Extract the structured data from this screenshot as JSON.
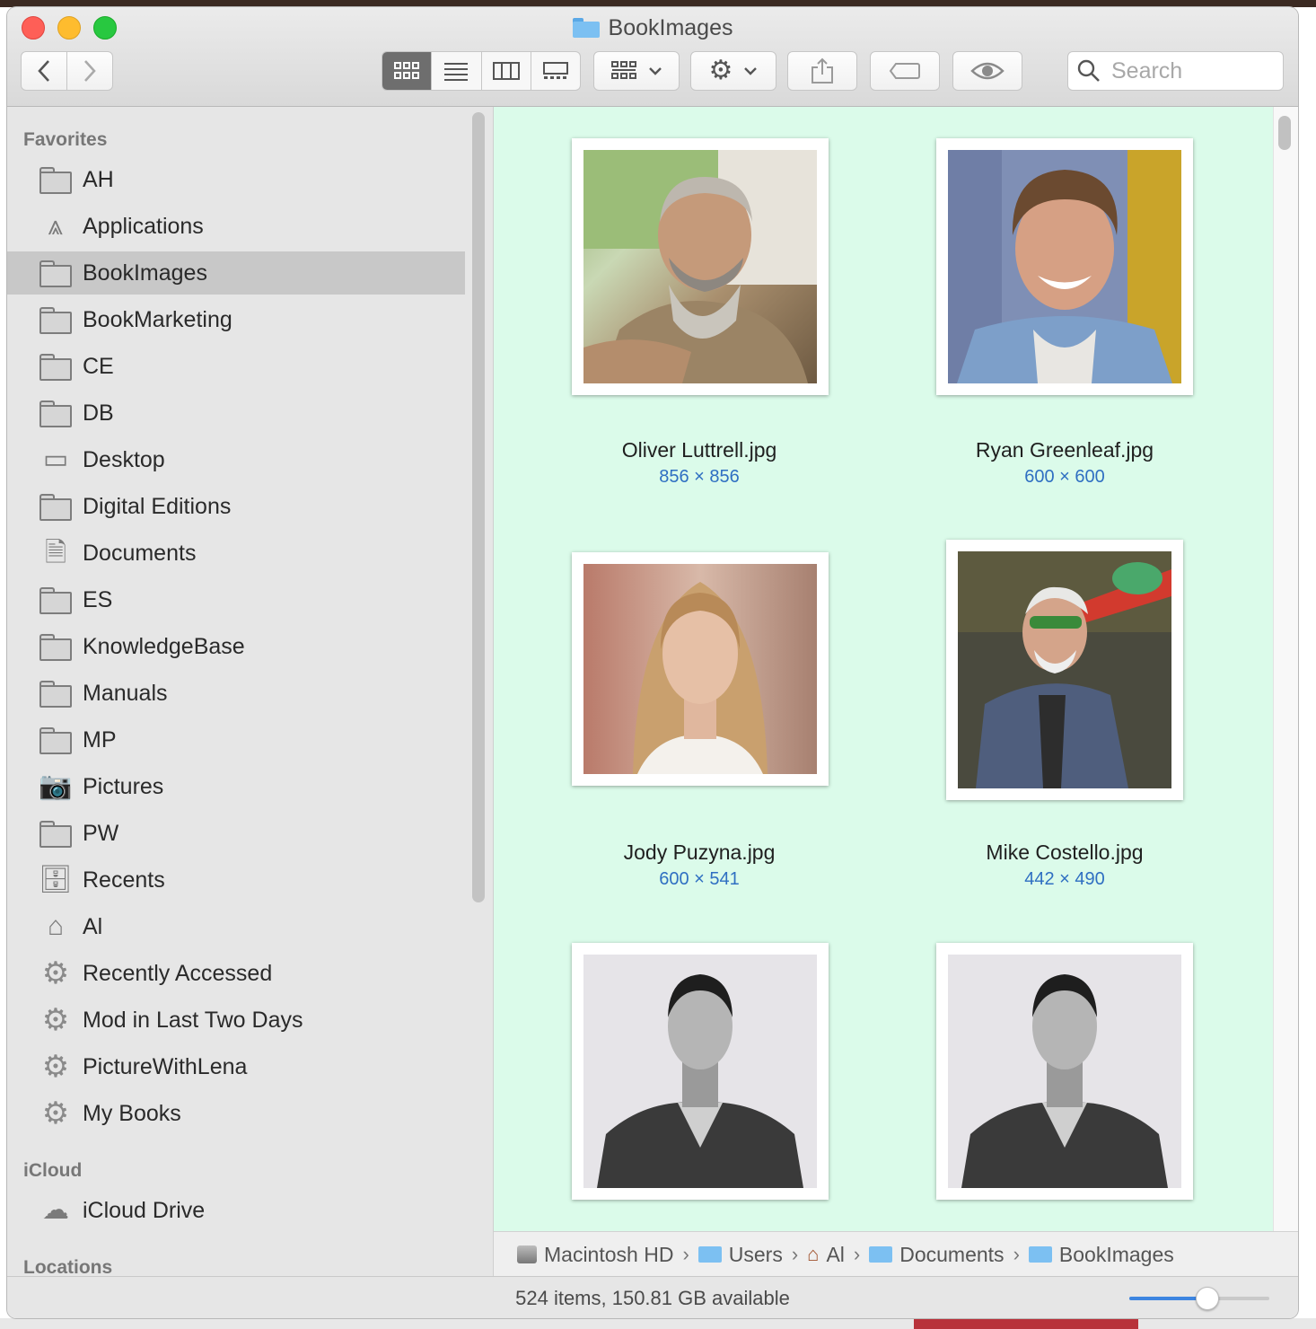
{
  "window": {
    "title": "BookImages"
  },
  "toolbar": {
    "back_label": "‹",
    "forward_label": "›",
    "view_icons": "icon-view",
    "view_list": "list-view",
    "view_columns": "column-view",
    "view_gallery": "gallery-view",
    "group_label": "▾",
    "action_label": "▾",
    "search_placeholder": "Search"
  },
  "sidebar": {
    "favorites_heading": "Favorites",
    "items": [
      {
        "label": "AH",
        "icon": "folder-icon"
      },
      {
        "label": "Applications",
        "icon": "applications-icon"
      },
      {
        "label": "BookImages",
        "icon": "folder-icon",
        "selected": true
      },
      {
        "label": "BookMarketing",
        "icon": "folder-icon"
      },
      {
        "label": "CE",
        "icon": "folder-icon"
      },
      {
        "label": "DB",
        "icon": "folder-icon"
      },
      {
        "label": "Desktop",
        "icon": "desktop-icon"
      },
      {
        "label": "Digital Editions",
        "icon": "folder-icon"
      },
      {
        "label": "Documents",
        "icon": "documents-icon"
      },
      {
        "label": "ES",
        "icon": "folder-icon"
      },
      {
        "label": "KnowledgeBase",
        "icon": "folder-icon"
      },
      {
        "label": "Manuals",
        "icon": "folder-icon"
      },
      {
        "label": "MP",
        "icon": "folder-icon"
      },
      {
        "label": "Pictures",
        "icon": "camera-icon"
      },
      {
        "label": "PW",
        "icon": "folder-icon"
      },
      {
        "label": "Recents",
        "icon": "recents-icon"
      },
      {
        "label": "Al",
        "icon": "home-icon"
      },
      {
        "label": "Recently Accessed",
        "icon": "gear-icon"
      },
      {
        "label": "Mod in Last Two Days",
        "icon": "gear-icon"
      },
      {
        "label": "PictureWithLena",
        "icon": "gear-icon"
      },
      {
        "label": "My Books",
        "icon": "gear-icon"
      }
    ],
    "icloud_heading": "iCloud",
    "icloud_items": [
      {
        "label": "iCloud Drive",
        "icon": "cloud-icon"
      }
    ],
    "locations_heading": "Locations"
  },
  "files": [
    {
      "name": "Oliver Luttrell.jpg",
      "dims": "856 × 856"
    },
    {
      "name": "Ryan Greenleaf.jpg",
      "dims": "600 × 600"
    },
    {
      "name": "Jody Puzyna.jpg",
      "dims": "600 × 541"
    },
    {
      "name": "Mike Costello.jpg",
      "dims": "442 × 490"
    },
    {
      "name": "",
      "dims": ""
    },
    {
      "name": "",
      "dims": ""
    }
  ],
  "pathbar": [
    {
      "label": "Macintosh HD",
      "icon": "hard-drive-icon"
    },
    {
      "label": "Users",
      "icon": "users-folder-icon"
    },
    {
      "label": "Al",
      "icon": "home-icon"
    },
    {
      "label": "Documents",
      "icon": "documents-folder-icon"
    },
    {
      "label": "BookImages",
      "icon": "folder-icon"
    }
  ],
  "status": {
    "text": "524 items, 150.81 GB available",
    "icon_size": 0.55
  },
  "colors": {
    "content_bg": "#dbfbea",
    "accent": "#3d85e0",
    "dims_text": "#2f6fc2"
  }
}
